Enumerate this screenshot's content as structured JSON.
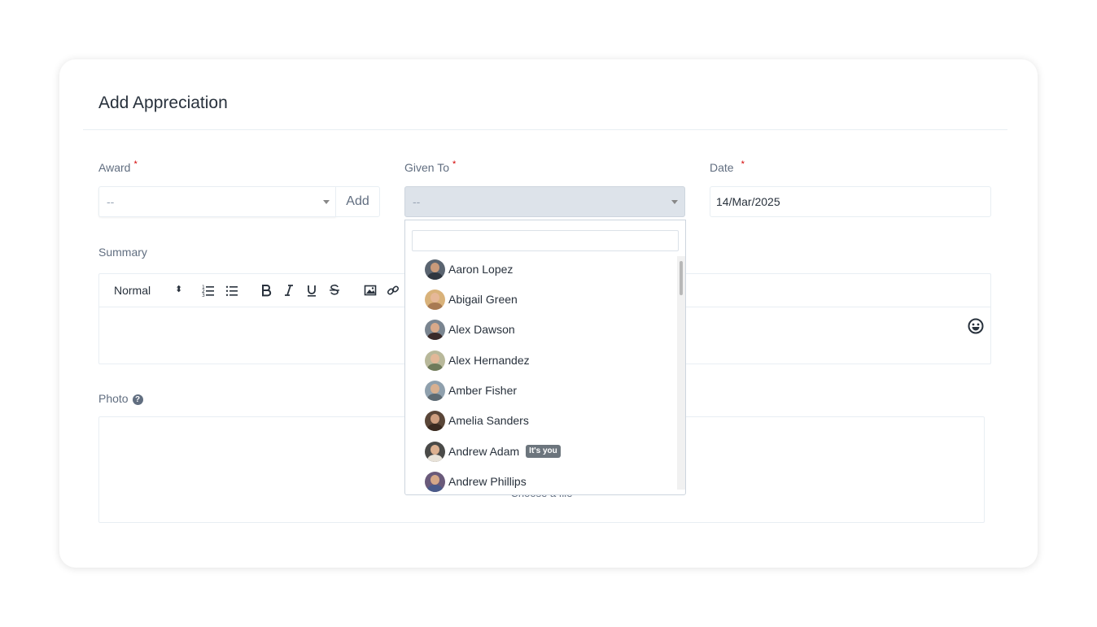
{
  "form": {
    "title": "Add Appreciation",
    "required_mark": "*",
    "award": {
      "label": "Award",
      "placeholder": "--",
      "add_label": "Add"
    },
    "given_to": {
      "label": "Given To",
      "placeholder": "--"
    },
    "date": {
      "label": "Date",
      "value": "14/Mar/2025"
    },
    "summary": {
      "label": "Summary",
      "format_select": "Normal",
      "toolbar_icons": [
        "ordered-list-icon",
        "bullet-list-icon",
        "bold-icon",
        "italic-icon",
        "underline-icon",
        "strikethrough-icon",
        "image-icon",
        "link-icon",
        "emoji-icon"
      ]
    },
    "photo": {
      "label": "Photo",
      "help_icon": "question-circle-icon",
      "choose_file": "Choose a file"
    }
  },
  "dropdown": {
    "search_value": "",
    "items": [
      {
        "name": "Aaron Lopez",
        "badge": ""
      },
      {
        "name": "Abigail Green",
        "badge": ""
      },
      {
        "name": "Alex Dawson",
        "badge": ""
      },
      {
        "name": "Alex Hernandez",
        "badge": ""
      },
      {
        "name": "Amber Fisher",
        "badge": ""
      },
      {
        "name": "Amelia Sanders",
        "badge": ""
      },
      {
        "name": "Andrew Adam",
        "badge": "It's you"
      },
      {
        "name": "Andrew Phillips",
        "badge": ""
      }
    ]
  },
  "colors": {
    "required": "#d30000",
    "label": "#616e80",
    "badge": "#6c757d"
  }
}
